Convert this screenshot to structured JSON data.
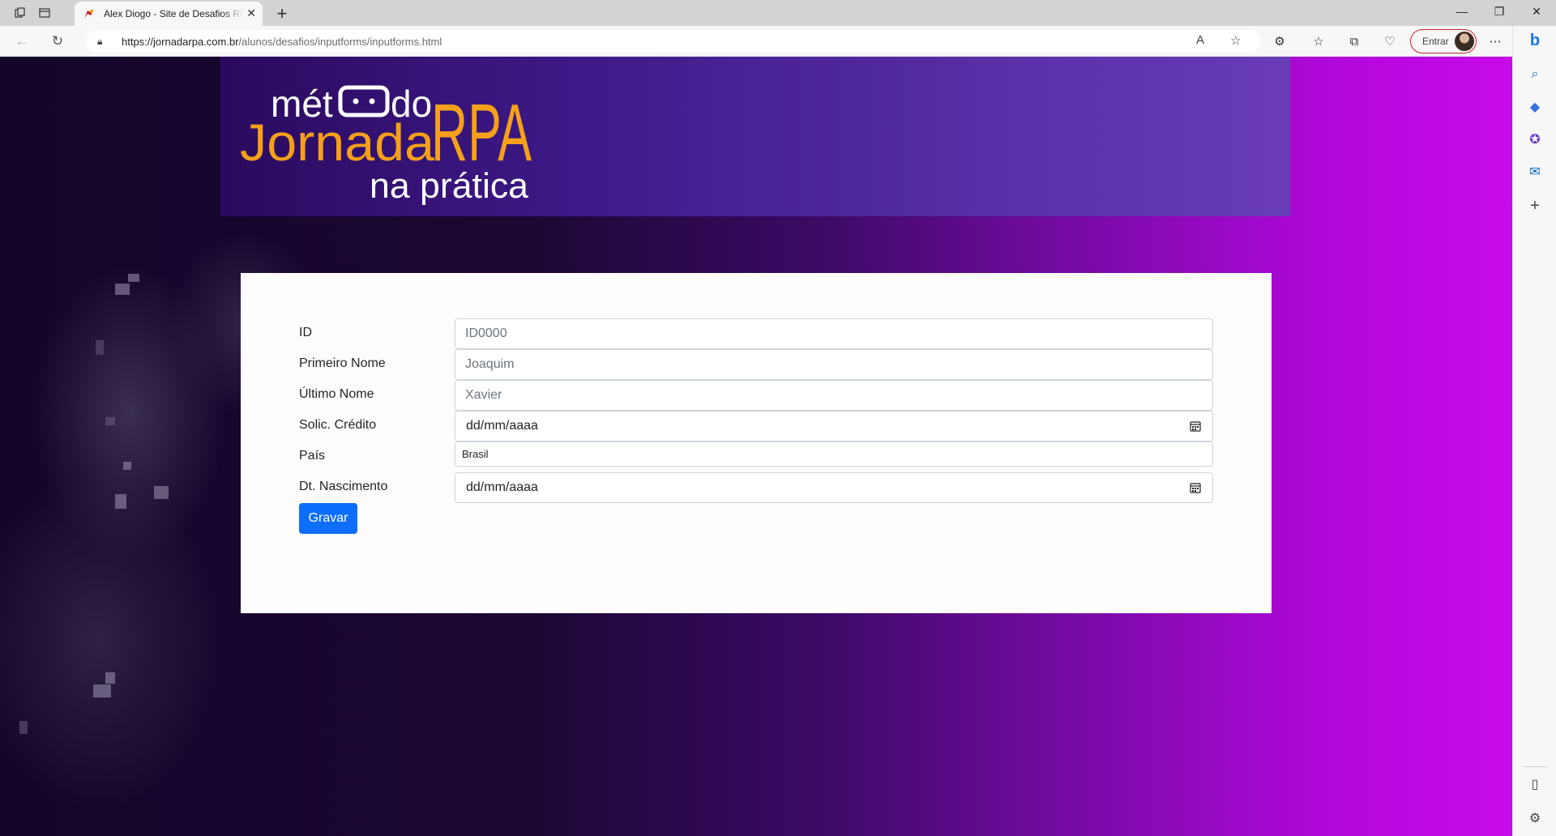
{
  "browser": {
    "tab_title": "Alex Diogo - Site de Desafios RPA",
    "url_host": "https://jornadarpa.com.br",
    "url_path": "/alunos/desafios/inputforms/inputforms.html",
    "signin_label": "Entrar"
  },
  "logo": {
    "line1": "mét",
    "line1b": "do",
    "line2": "Jornada",
    "line2b": "RPA",
    "line3": "na prática",
    "color_orange": "#f5a01a",
    "color_white": "#ffffff"
  },
  "form": {
    "fields": [
      {
        "label": "ID",
        "placeholder": "ID0000"
      },
      {
        "label": "Primeiro Nome",
        "placeholder": "Joaquim"
      },
      {
        "label": "Último Nome",
        "placeholder": "Xavier"
      },
      {
        "label": "Solic. Crédito",
        "value": "dd/mm/aaaa"
      },
      {
        "label": "País",
        "value": "Brasil"
      },
      {
        "label": "Dt. Nascimento",
        "value": "dd/mm/aaaa"
      }
    ],
    "submit_label": "Gravar"
  },
  "colors": {
    "primary_button": "#0d6efd",
    "banner": "#3f1a8a",
    "background_right": "#c70ae8"
  }
}
